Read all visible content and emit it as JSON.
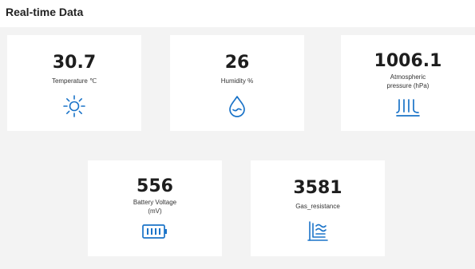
{
  "header": {
    "title": "Real-time Data"
  },
  "cards": [
    {
      "value": "30.7",
      "label": "Temperature ℃",
      "icon": "sun-icon"
    },
    {
      "value": "26",
      "label": "Humidity %",
      "icon": "water-drop-icon"
    },
    {
      "value": "1006.1",
      "label_line1": "Atmospheric",
      "label_line2": "pressure (hPa)",
      "icon": "pressure-icon"
    },
    {
      "value": "556",
      "label_line1": "Battery Voltage",
      "label_line2": "(mV)",
      "icon": "battery-icon"
    },
    {
      "value": "3581",
      "label": "Gas_resistance",
      "icon": "gas-resistance-icon"
    }
  ],
  "colors": {
    "accent": "#1a73c8",
    "panel_bg": "#f3f3f3",
    "card_bg": "#ffffff"
  }
}
